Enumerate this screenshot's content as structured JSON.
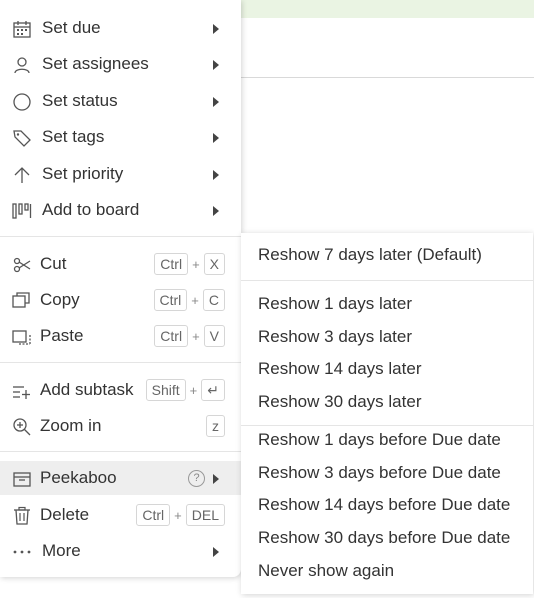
{
  "menu": {
    "items": [
      {
        "label": "Set due",
        "icon": "calendar-icon"
      },
      {
        "label": "Set assignees",
        "icon": "user-icon"
      },
      {
        "label": "Set status",
        "icon": "circle-icon"
      },
      {
        "label": "Set tags",
        "icon": "tag-icon"
      },
      {
        "label": "Set priority",
        "icon": "arrow-up-icon"
      },
      {
        "label": "Add to board",
        "icon": "board-icon"
      },
      {
        "label": "Cut",
        "icon": "scissors-icon",
        "keys": [
          "Ctrl",
          "X"
        ]
      },
      {
        "label": "Copy",
        "icon": "copy-icon",
        "keys": [
          "Ctrl",
          "C"
        ]
      },
      {
        "label": "Paste",
        "icon": "paste-icon",
        "keys": [
          "Ctrl",
          "V"
        ]
      },
      {
        "label": "Add subtask",
        "icon": "subtask-icon",
        "keys": [
          "Shift",
          "↵"
        ]
      },
      {
        "label": "Zoom in",
        "icon": "zoom-in-icon",
        "keys": [
          "z"
        ]
      },
      {
        "label": "Peekaboo",
        "icon": "peekaboo-icon",
        "help": "?"
      },
      {
        "label": "Delete",
        "icon": "trash-icon",
        "keys": [
          "Ctrl",
          "DEL"
        ]
      },
      {
        "label": "More",
        "icon": "more-icon"
      }
    ]
  },
  "submenu": {
    "items": [
      "Reshow 7 days later (Default)",
      "Reshow 1 days later",
      "Reshow 3 days later",
      "Reshow 14 days later",
      "Reshow 30 days later",
      "Reshow 1 days before Due date",
      "Reshow 3 days before Due date",
      "Reshow 14 days before Due date",
      "Reshow 30 days before Due date",
      "Never show again"
    ]
  }
}
